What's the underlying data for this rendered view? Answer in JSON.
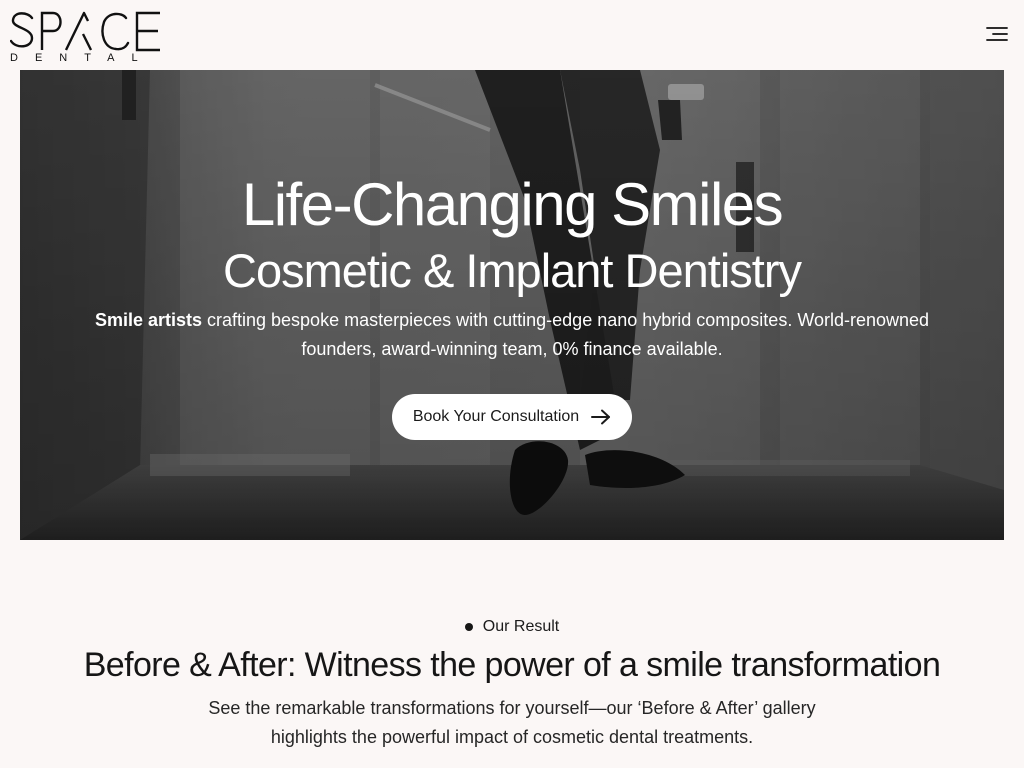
{
  "header": {
    "logo": {
      "wordmark": "SPACE",
      "tagline": "DENTAL"
    },
    "menu_icon": "hamburger-menu-icon"
  },
  "hero": {
    "title": "Life-Changing Smiles",
    "subtitle": "Cosmetic & Implant Dentistry",
    "description_strong": "Smile artists",
    "description_rest": " crafting bespoke masterpieces with cutting-edge nano hybrid composites. World-renowned founders, award-winning team, 0% finance available.",
    "cta_label": "Book Your Consultation",
    "cta_icon": "arrow-right-icon"
  },
  "results": {
    "eyebrow": "Our Result",
    "title": "Before & After: Witness the power of a smile transformation",
    "description": "See the remarkable transformations for yourself—our ‘Before & After’ gallery highlights the powerful impact of cosmetic dental treatments."
  },
  "colors": {
    "page_background": "#fbf7f6",
    "text_primary": "#161616",
    "button_background": "#ffffff"
  }
}
